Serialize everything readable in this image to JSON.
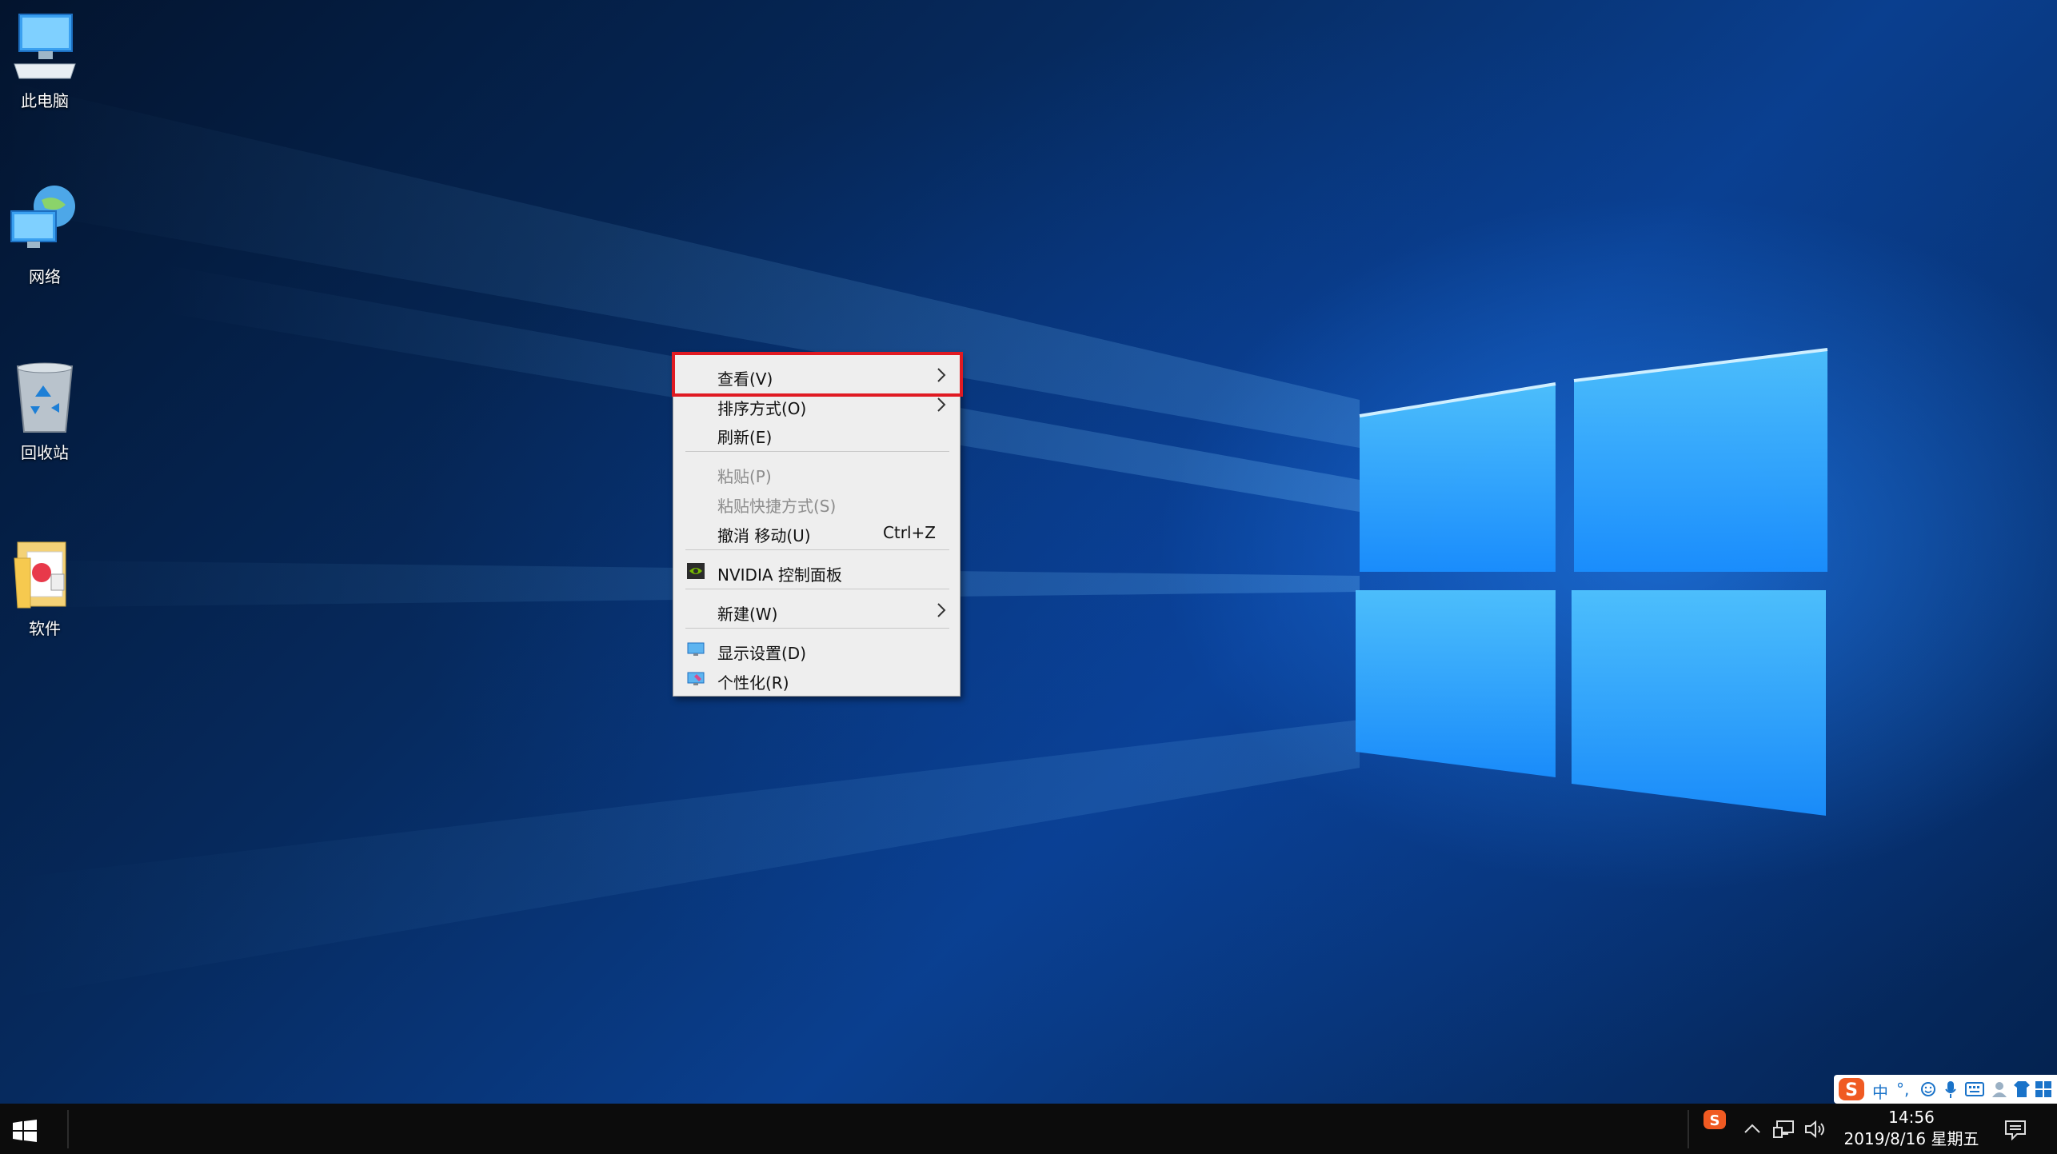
{
  "desktop": {
    "icons": [
      {
        "label": "此电脑",
        "icon": "computer-icon"
      },
      {
        "label": "网络",
        "icon": "network-icon"
      },
      {
        "label": "回收站",
        "icon": "recycle-bin-icon"
      },
      {
        "label": "软件",
        "icon": "folder-icon"
      }
    ]
  },
  "context_menu": {
    "view": "查看(V)",
    "sort": "排序方式(O)",
    "refresh": "刷新(E)",
    "paste": "粘贴(P)",
    "paste_shortcut": "粘贴快捷方式(S)",
    "undo": "撤消 移动(U)",
    "undo_shortcut": "Ctrl+Z",
    "nvidia": "NVIDIA 控制面板",
    "new": "新建(W)",
    "display": "显示设置(D)",
    "personalize": "个性化(R)"
  },
  "ime_toolbar": {
    "lang": "中",
    "punct": "°,"
  },
  "taskbar": {
    "time": "14:56",
    "date": "2019/8/16 星期五"
  },
  "colors": {
    "highlight_border": "#e01a22",
    "taskbar": "#0c0c0c",
    "menu_bg": "#eeeeee"
  }
}
